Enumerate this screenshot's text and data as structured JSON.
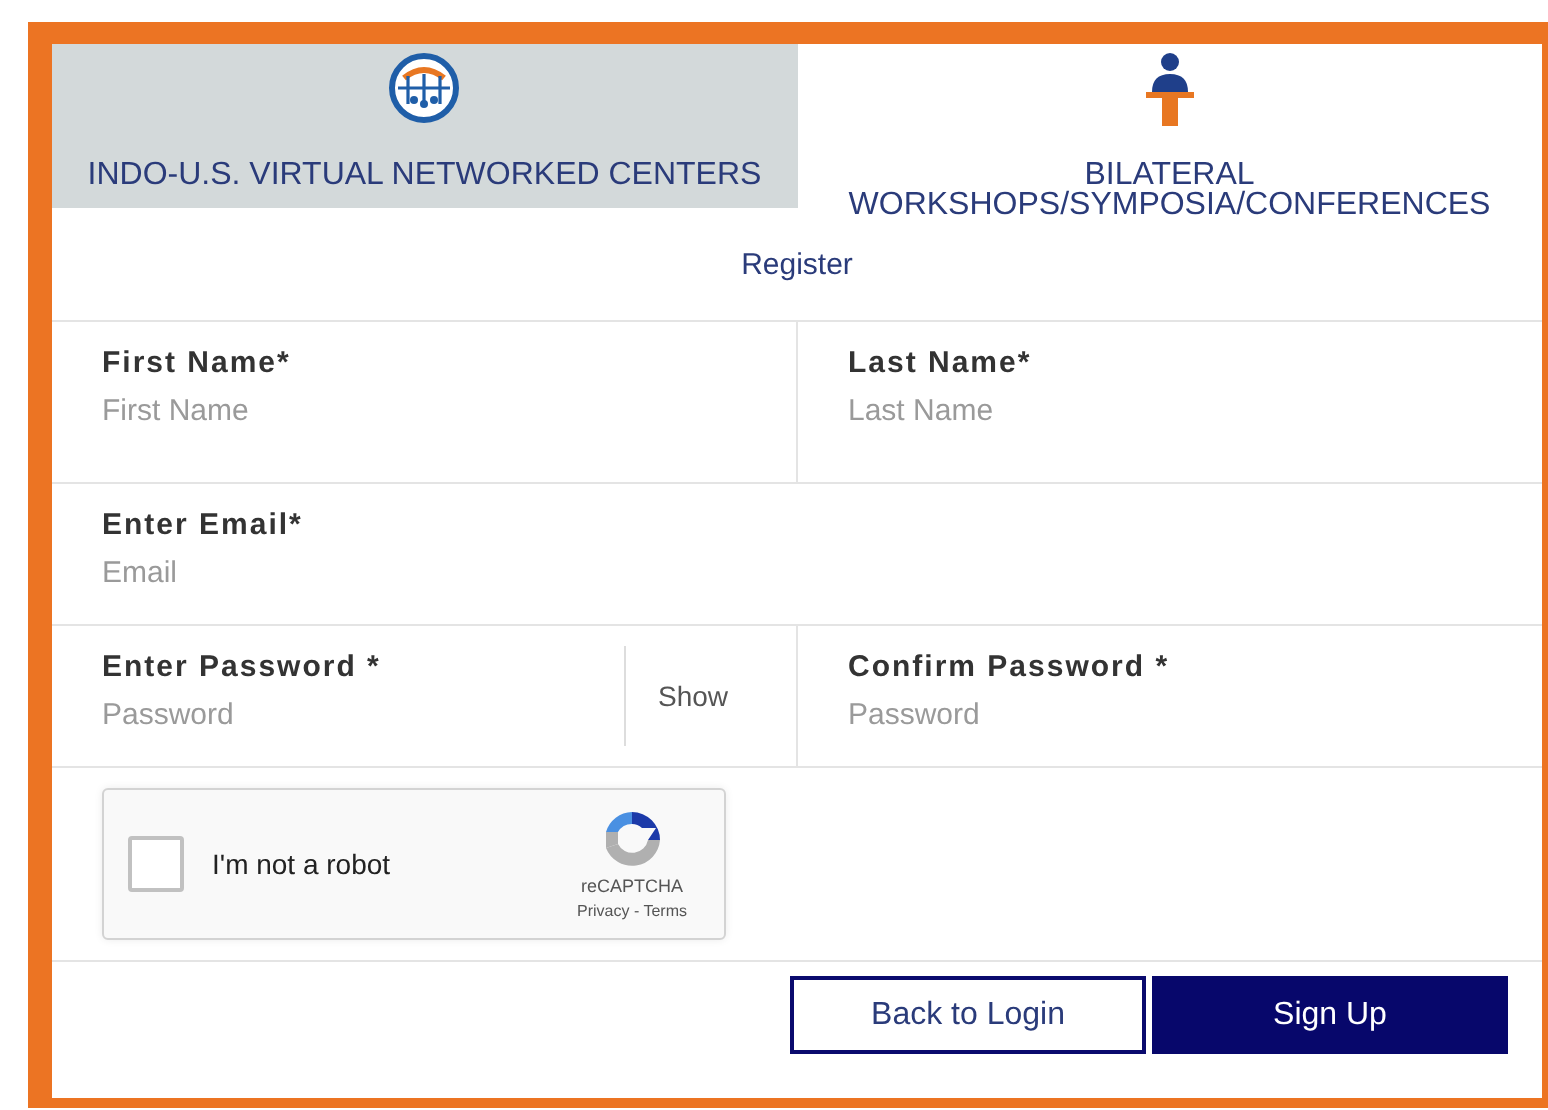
{
  "tabs": [
    {
      "label": "INDO-U.S. VIRTUAL NETWORKED CENTERS",
      "kind": "globe",
      "selected": true
    },
    {
      "label": "BILATERAL WORKSHOPS/SYMPOSIA/CONFERENCES",
      "kind": "speaker",
      "selected": false
    }
  ],
  "heading": "Register",
  "rows": [
    [
      {
        "label": "First Name*",
        "placeholder": "First Name"
      },
      {
        "label": "Last Name*",
        "placeholder": "Last Name"
      }
    ],
    [
      {
        "label": "Enter Email*",
        "placeholder": "Email"
      }
    ],
    [
      {
        "label": "Enter Password *",
        "placeholder": "Password",
        "toggle": "Show"
      },
      {
        "label": "Confirm Password *",
        "placeholder": "Password"
      }
    ]
  ],
  "captcha": {
    "label": "I'm not a robot",
    "checked": false,
    "brand": "reCAPTCHA",
    "links": "Privacy - Terms"
  },
  "buttons": [
    {
      "label": "Back to Login",
      "kind": "secondary"
    },
    {
      "label": "Sign Up",
      "kind": "primary"
    }
  ]
}
